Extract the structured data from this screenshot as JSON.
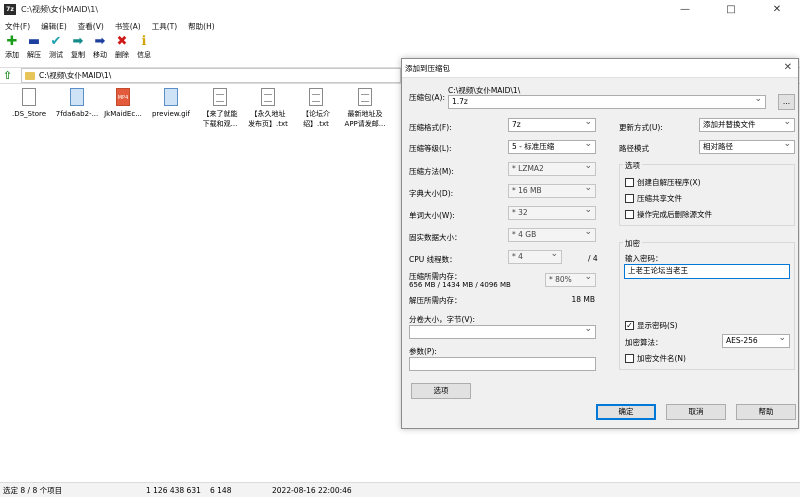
{
  "window": {
    "title": "C:\\视频\\女仆MAID\\1\\",
    "app_icon": "7z"
  },
  "menu": [
    "文件(F)",
    "编辑(E)",
    "查看(V)",
    "书签(A)",
    "工具(T)",
    "帮助(H)"
  ],
  "toolbar": [
    {
      "label": "添加",
      "icon": "plus-icon",
      "glyph": "✚",
      "color": "#1a9d1a"
    },
    {
      "label": "解压",
      "icon": "minus-icon",
      "glyph": "▬",
      "color": "#1d3f9e"
    },
    {
      "label": "测试",
      "icon": "check-icon",
      "glyph": "✔",
      "color": "#1aa0b0"
    },
    {
      "label": "复制",
      "icon": "copy-arrow-icon",
      "glyph": "➡",
      "color": "#158a8a"
    },
    {
      "label": "移动",
      "icon": "move-arrow-icon",
      "glyph": "➡",
      "color": "#1d3f9e"
    },
    {
      "label": "删除",
      "icon": "delete-x-icon",
      "glyph": "✖",
      "color": "#d01919"
    },
    {
      "label": "信息",
      "icon": "info-icon",
      "glyph": "ℹ",
      "color": "#d4a400"
    }
  ],
  "address": {
    "path": "C:\\视频\\女仆MAID\\1\\"
  },
  "files": [
    {
      "name": ".DS_Store",
      "type": "doc"
    },
    {
      "name": "7fda6ab2-...",
      "type": "gif"
    },
    {
      "name": "JkMaidEc...",
      "type": "mp4",
      "badge": "MP4"
    },
    {
      "name": "preview.gif",
      "type": "gif"
    },
    {
      "name": "【来了就能\n下载和观...",
      "type": "text"
    },
    {
      "name": "【永久地址\n发布页】.txt",
      "type": "text"
    },
    {
      "name": "【论坛介\n绍】.txt",
      "type": "text"
    },
    {
      "name": "最新地址及\nAPP请发邮...",
      "type": "text"
    }
  ],
  "status": {
    "selected": "选定 8 / 8 个项目",
    "size": "1 126 438 631",
    "packed": "6 148",
    "modified": "2022-08-16 22:00:46"
  },
  "dialog": {
    "title": "添加到压缩包",
    "archive_label": "压缩包(A):",
    "archive_dir": "C:\\视频\\女仆MAID\\1\\",
    "archive_name": "1.7z",
    "browse": "...",
    "format_label": "压缩格式(F):",
    "format": "7z",
    "level_label": "压缩等级(L):",
    "level": "5 - 标准压缩",
    "method_label": "压缩方法(M):",
    "method": "* LZMA2",
    "dict_label": "字典大小(D):",
    "dict": "* 16 MB",
    "word_label": "单词大小(W):",
    "word": "* 32",
    "solid_label": "固实数据大小：",
    "solid": "* 4 GB",
    "cpu_label": "CPU 线程数：",
    "cpu": "* 4",
    "cpu_total": "/ 4",
    "mem_label": "压缩所需内存：",
    "mem_values": "656 MB / 1434 MB / 4096 MB",
    "mem_percent": "* 80%",
    "decomp_label": "解压所需内存：",
    "decomp": "18 MB",
    "split_label": "分卷大小，字节(V):",
    "split": "",
    "params_label": "参数(P):",
    "params": "",
    "options_btn": "选项",
    "update_label": "更新方式(U):",
    "update": "添加并替换文件",
    "path_label": "路径模式",
    "path": "相对路径",
    "options_group": "选项",
    "opt_sfx": "创建自解压程序(X)",
    "opt_shared": "压缩共享文件",
    "opt_delete": "操作完成后删除源文件",
    "encrypt_group": "加密",
    "password_label": "输入密码：",
    "password": "上老王论坛当老王",
    "show_pwd": "显示密码(S)",
    "enc_method_label": "加密算法：",
    "enc_method": "AES-256",
    "enc_names": "加密文件名(N)",
    "ok": "确定",
    "cancel": "取消",
    "help": "帮助"
  }
}
